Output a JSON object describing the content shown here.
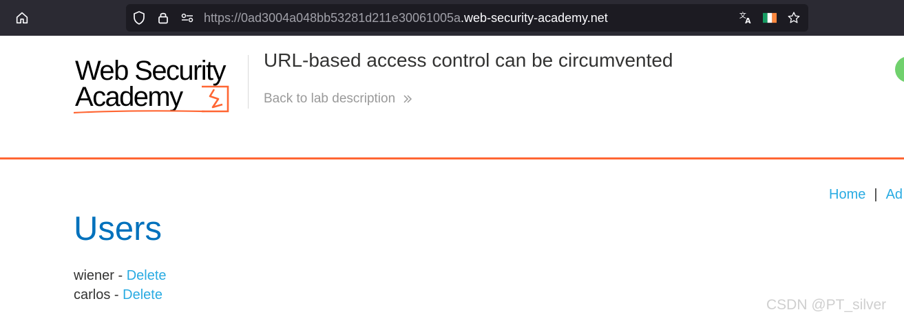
{
  "browser": {
    "url_dim": "https://0ad3004a048bb53281d211e30061005a",
    "url_domain": ".web-security-academy.net",
    "icons": [
      "home-icon",
      "shield-icon",
      "lock-icon",
      "permissions-icon",
      "translate-icon",
      "flag-icon",
      "bookmark-star-icon"
    ],
    "flag_colors": [
      "#169b62",
      "#ffffff",
      "#ff883e"
    ]
  },
  "lab": {
    "logo_line1": "Web Security",
    "logo_line2": "Academy",
    "title": "URL-based access control can be circumvented",
    "back_link": "Back to lab description",
    "status_color": "#70d16d",
    "accent_color": "#ff6633"
  },
  "nav": {
    "home": "Home",
    "separator": "|",
    "admin_partial": "Ad"
  },
  "main": {
    "heading": "Users",
    "users": [
      {
        "name": "wiener",
        "sep": " - ",
        "action": "Delete"
      },
      {
        "name": "carlos",
        "sep": " - ",
        "action": "Delete"
      }
    ]
  },
  "watermark": "CSDN @PT_silver",
  "colors": {
    "heading_blue": "#0071bc",
    "link_blue": "#29abe2",
    "text_dark": "#333332"
  }
}
